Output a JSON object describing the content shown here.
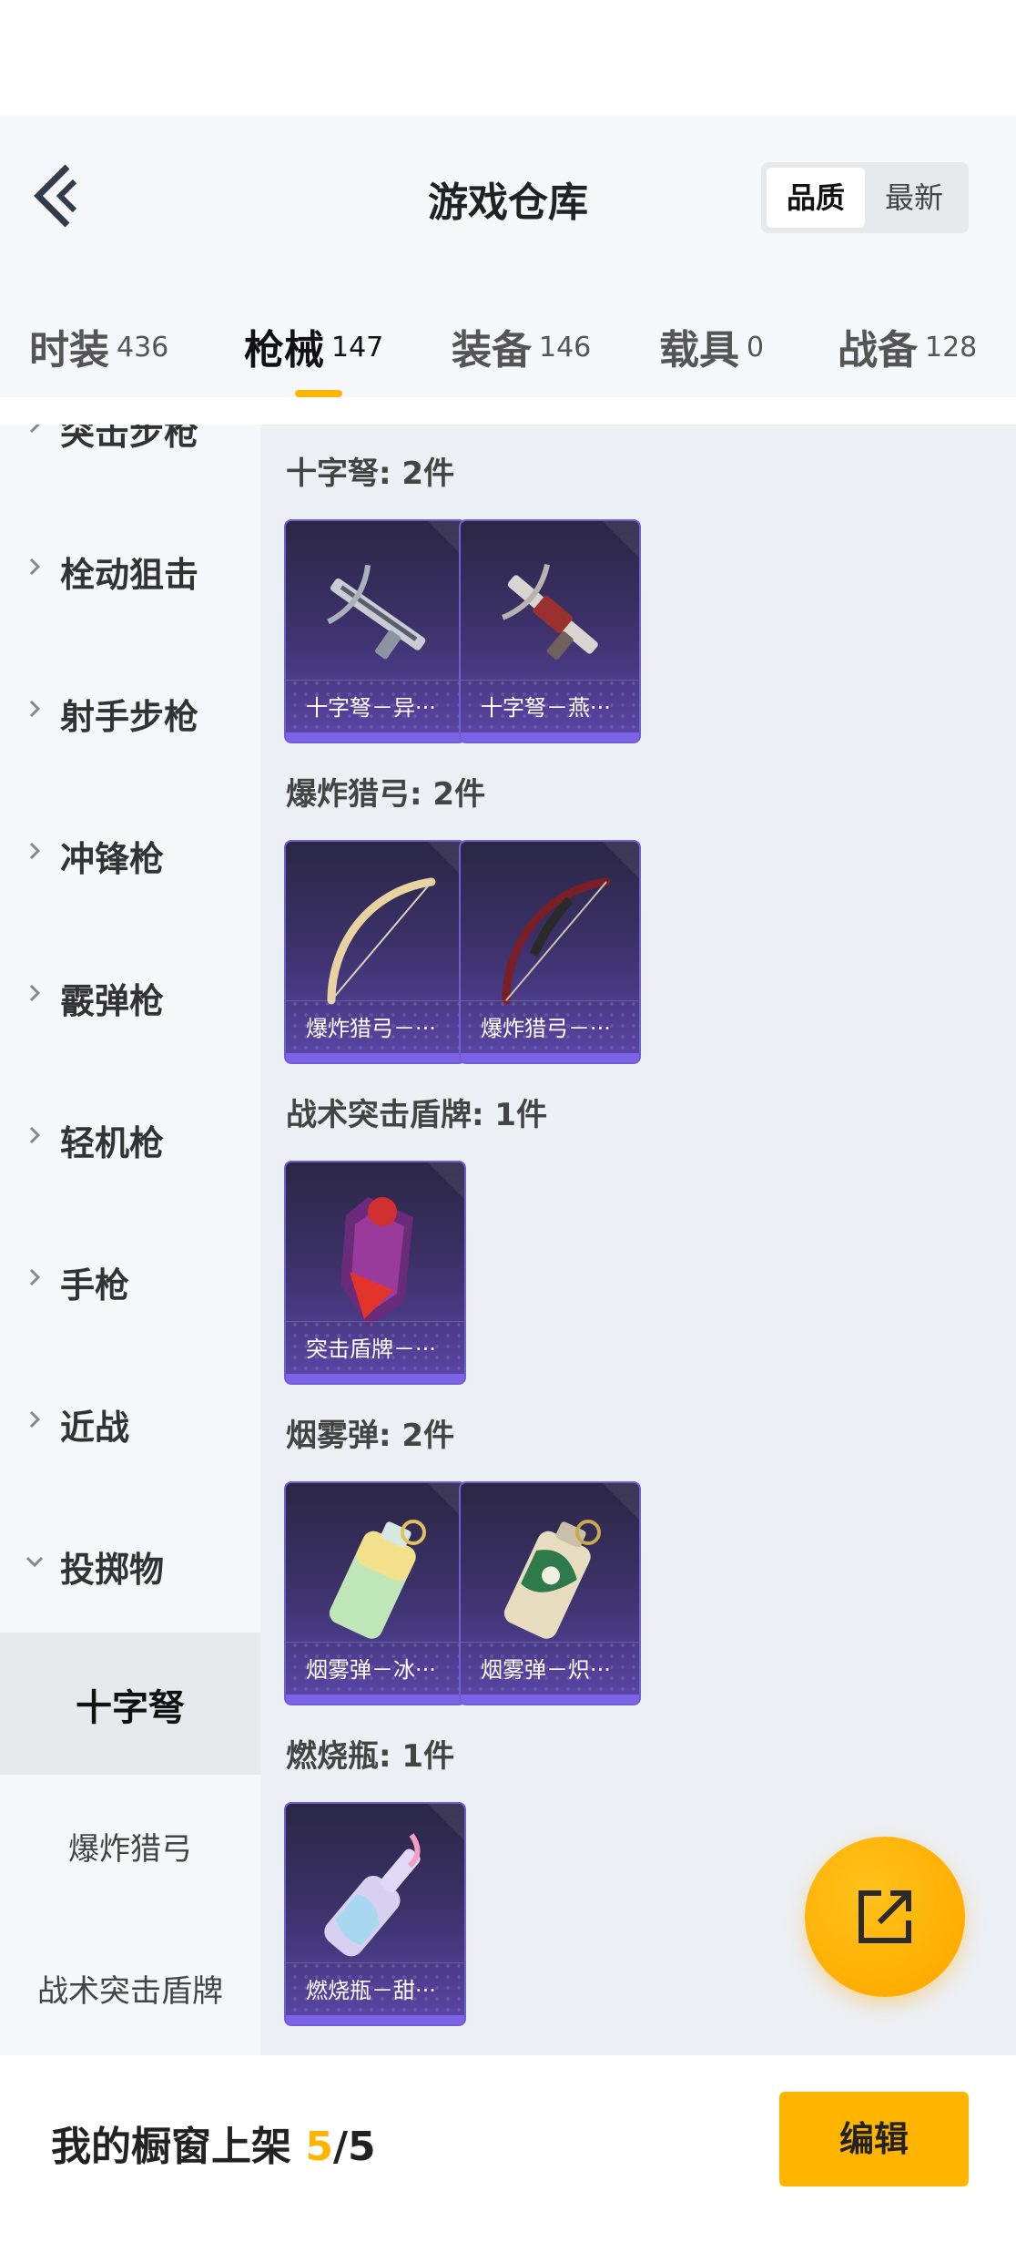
{
  "header": {
    "title": "游戏仓库",
    "sort_options": [
      "品质",
      "最新"
    ]
  },
  "tabs": [
    {
      "label": "时装",
      "count": "436"
    },
    {
      "label": "枪械",
      "count": "147"
    },
    {
      "label": "装备",
      "count": "146"
    },
    {
      "label": "载具",
      "count": "0"
    },
    {
      "label": "战备",
      "count": "128"
    }
  ],
  "sidebar": {
    "items": [
      {
        "label": "突击步枪"
      },
      {
        "label": "栓动狙击"
      },
      {
        "label": "射手步枪"
      },
      {
        "label": "冲锋枪"
      },
      {
        "label": "霰弹枪"
      },
      {
        "label": "轻机枪"
      },
      {
        "label": "手枪"
      },
      {
        "label": "近战"
      },
      {
        "label": "投掷物"
      }
    ],
    "subitems": [
      {
        "label": "十字弩"
      },
      {
        "label": "爆炸猎弓"
      },
      {
        "label": "战术突击盾牌"
      }
    ]
  },
  "groups": [
    {
      "title": "十字弩: 2件",
      "cards": [
        {
          "label": "十字弩－异···",
          "icon": "crossbow-icon"
        },
        {
          "label": "十字弩－燕···",
          "icon": "crossbow-icon"
        }
      ]
    },
    {
      "title": "爆炸猎弓: 2件",
      "cards": [
        {
          "label": "爆炸猎弓－···",
          "icon": "bow-icon"
        },
        {
          "label": "爆炸猎弓－···",
          "icon": "bow-icon"
        }
      ]
    },
    {
      "title": "战术突击盾牌: 1件",
      "cards": [
        {
          "label": "突击盾牌－···",
          "icon": "shield-icon"
        }
      ]
    },
    {
      "title": "烟雾弹: 2件",
      "cards": [
        {
          "label": "烟雾弹－冰···",
          "icon": "smoke-grenade-icon"
        },
        {
          "label": "烟雾弹－炽···",
          "icon": "smoke-grenade-icon"
        }
      ]
    },
    {
      "title": "燃烧瓶: 1件",
      "cards": [
        {
          "label": "燃烧瓶－甜···",
          "icon": "molotov-icon"
        }
      ]
    }
  ],
  "bottom": {
    "shelf_label": "我的橱窗上架 ",
    "shelf_current": "5",
    "shelf_total": "/5",
    "edit_label": "编辑"
  },
  "colors": {
    "accent": "#ffb400",
    "card_purple": "#5a46a8"
  }
}
